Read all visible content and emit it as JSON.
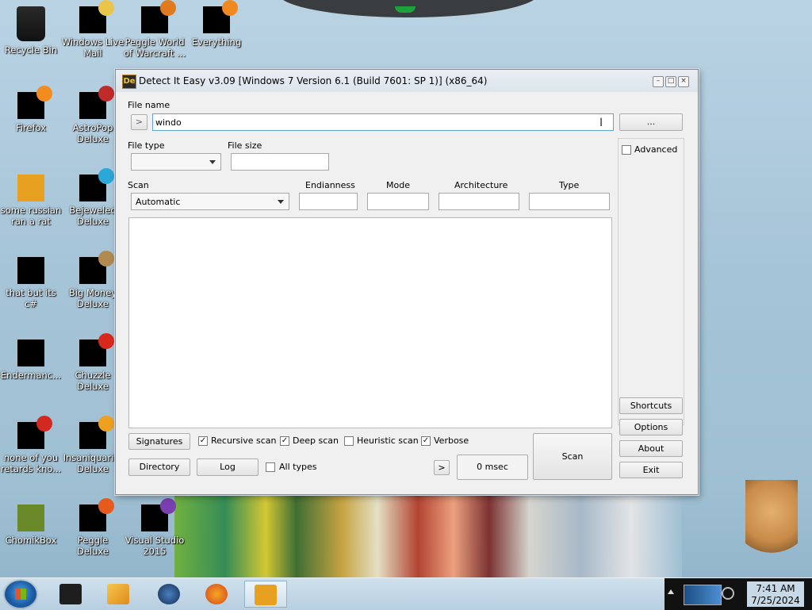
{
  "desktop": {
    "icons": [
      {
        "label": "Recycle Bin"
      },
      {
        "label": "Windows Live Mail"
      },
      {
        "label": "Peggle World of Warcraft ..."
      },
      {
        "label": "Everything"
      },
      {
        "label": "Firefox"
      },
      {
        "label": "AstroPop Deluxe"
      },
      {
        "label": "some russian ran a rat"
      },
      {
        "label": "Bejeweled Deluxe"
      },
      {
        "label": "that but its c#"
      },
      {
        "label": "Big Money Deluxe"
      },
      {
        "label": "Endermanc..."
      },
      {
        "label": "Chuzzle Deluxe"
      },
      {
        "label": "none of you retards kno..."
      },
      {
        "label": "Insaniquari... Deluxe"
      },
      {
        "label": "ChomikBox"
      },
      {
        "label": "Peggle Deluxe"
      },
      {
        "label": "Visual Studio 2015"
      }
    ]
  },
  "window": {
    "title": "Detect It Easy v3.09 [Windows 7 Version 6.1 (Build 7601: SP 1)] (x86_64)",
    "icon_text": "De",
    "controls": {
      "minimize": "–",
      "maximize": "□",
      "close": "×"
    }
  },
  "form": {
    "file_name_label": "File name",
    "go_button": ">",
    "file_name_value": "windo",
    "browse_button": "...",
    "file_type_label": "File type",
    "file_type_value": "",
    "file_size_label": "File size",
    "file_size_value": "",
    "advanced_label": "Advanced",
    "advanced_checked": false,
    "scan_label": "Scan",
    "scan_mode_value": "Automatic",
    "endianness_label": "Endianness",
    "endianness_value": "",
    "mode_label": "Mode",
    "mode_value": "",
    "architecture_label": "Architecture",
    "architecture_value": "",
    "type_label": "Type",
    "type_value": ""
  },
  "side_buttons": {
    "shortcuts": "Shortcuts",
    "options": "Options",
    "about": "About",
    "exit": "Exit"
  },
  "bottom": {
    "signatures": "Signatures",
    "recursive_scan": "Recursive scan",
    "recursive_scan_checked": true,
    "deep_scan": "Deep scan",
    "deep_scan_checked": true,
    "heuristic_scan": "Heuristic scan",
    "heuristic_scan_checked": false,
    "verbose": "Verbose",
    "verbose_checked": true,
    "directory": "Directory",
    "log": "Log",
    "all_types": "All types",
    "all_types_checked": false,
    "next_button": ">",
    "time": "0 msec",
    "scan_button": "Scan"
  },
  "taskbar": {
    "clock_time": "7:41 AM",
    "clock_date": "7/25/2024",
    "check_mark": "✓"
  }
}
